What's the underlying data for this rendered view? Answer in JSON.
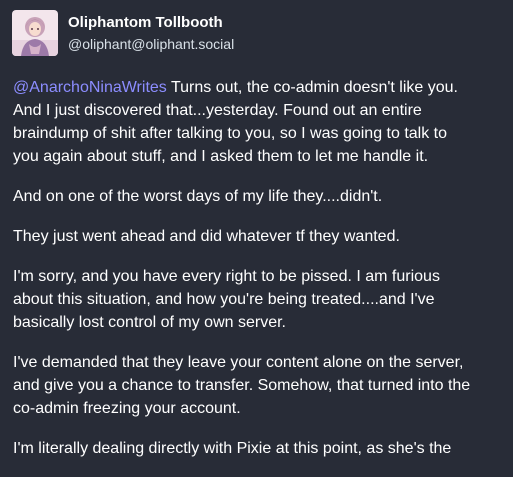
{
  "author": {
    "display_name": "Oliphantom Tollbooth",
    "handle": "@oliphant@oliphant.social",
    "avatar_icon": "avatar-portrait-icon"
  },
  "post": {
    "mention": "@AnarchoNinaWrites",
    "paragraphs": [
      {
        "lines": [
          " Turns out, the co-admin doesn't like you.",
          "And I just discovered that...yesterday. Found out an entire",
          "braindump of shit after talking to you, so I was going to talk to",
          "you again about stuff, and I asked them to let me handle it."
        ]
      },
      {
        "lines": [
          "And on one of the worst days of my life they....didn't."
        ]
      },
      {
        "lines": [
          "They just went ahead and did whatever tf they wanted."
        ]
      },
      {
        "lines": [
          "I'm sorry, and you have every right to be pissed. I am furious",
          "about this situation, and how you're being treated....and I've",
          "basically lost control of my own server."
        ]
      },
      {
        "lines": [
          "I've demanded that they leave your content alone on the server,",
          "and give you a chance to transfer. Somehow, that turned into the",
          "co-admin freezing your account."
        ]
      },
      {
        "lines": [
          "I'm literally dealing directly with Pixie at this point, as she's the"
        ]
      }
    ]
  },
  "colors": {
    "background": "#282c37",
    "text": "#ffffff",
    "secondary_text": "#d9e1e8",
    "mention": "#8c8dff"
  }
}
